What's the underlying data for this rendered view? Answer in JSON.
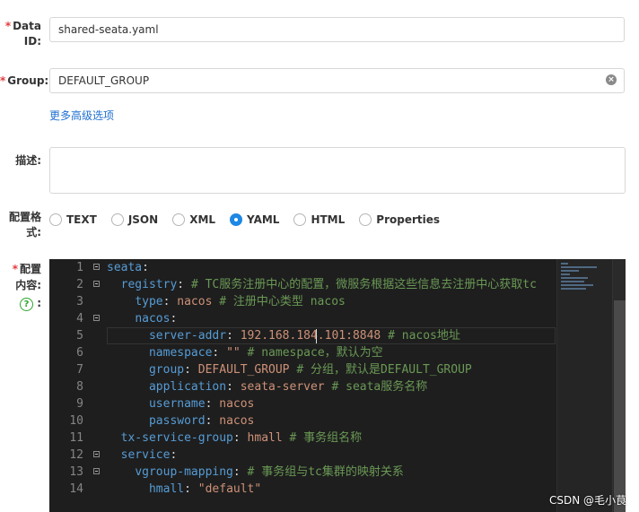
{
  "form": {
    "data_id": {
      "required_mark": "*",
      "label_line1": "Data",
      "label_line2": "ID:",
      "value": "shared-seata.yaml"
    },
    "group": {
      "required_mark": "*",
      "label": "Group:",
      "value": "DEFAULT_GROUP",
      "clear_icon": "clear-circle-icon"
    },
    "advanced_link": "更多高级选项",
    "description": {
      "label": "描述:",
      "value": ""
    },
    "format": {
      "label_line1": "配置格",
      "label_line2": "式:",
      "options": [
        "TEXT",
        "JSON",
        "XML",
        "YAML",
        "HTML",
        "Properties"
      ],
      "selected": "YAML"
    },
    "content": {
      "required_mark": "*",
      "label_line1": "配置",
      "label_line2": "内容:",
      "help_icon": "?",
      "colon": ":"
    }
  },
  "editor": {
    "cursor_line": 5,
    "lines": [
      {
        "n": "1",
        "fold": true,
        "indent": "",
        "key": "seata",
        "sep": ":",
        "val": "",
        "comment": ""
      },
      {
        "n": "2",
        "fold": true,
        "indent": "  ",
        "key": "registry",
        "sep": ": ",
        "val": "",
        "comment": "# TC服务注册中心的配置，微服务根据这些信息去注册中心获取tc"
      },
      {
        "n": "3",
        "fold": false,
        "indent": "    ",
        "key": "type",
        "sep": ": ",
        "val": "nacos",
        "comment": " # 注册中心类型 nacos"
      },
      {
        "n": "4",
        "fold": true,
        "indent": "    ",
        "key": "nacos",
        "sep": ":",
        "val": "",
        "comment": ""
      },
      {
        "n": "5",
        "fold": false,
        "indent": "      ",
        "key": "server-addr",
        "sep": ": ",
        "val": "192.168.184.101:8848",
        "comment": " # nacos地址"
      },
      {
        "n": "6",
        "fold": false,
        "indent": "      ",
        "key": "namespace",
        "sep": ": ",
        "val": "\"\"",
        "comment": " # namespace，默认为空"
      },
      {
        "n": "7",
        "fold": false,
        "indent": "      ",
        "key": "group",
        "sep": ": ",
        "val": "DEFAULT_GROUP",
        "comment": " # 分组，默认是DEFAULT_GROUP"
      },
      {
        "n": "8",
        "fold": false,
        "indent": "      ",
        "key": "application",
        "sep": ": ",
        "val": "seata-server",
        "comment": " # seata服务名称"
      },
      {
        "n": "9",
        "fold": false,
        "indent": "      ",
        "key": "username",
        "sep": ": ",
        "val": "nacos",
        "comment": ""
      },
      {
        "n": "10",
        "fold": false,
        "indent": "      ",
        "key": "password",
        "sep": ": ",
        "val": "nacos",
        "comment": ""
      },
      {
        "n": "11",
        "fold": false,
        "indent": "  ",
        "key": "tx-service-group",
        "sep": ": ",
        "val": "hmall",
        "comment": " # 事务组名称"
      },
      {
        "n": "12",
        "fold": true,
        "indent": "  ",
        "key": "service",
        "sep": ":",
        "val": "",
        "comment": ""
      },
      {
        "n": "13",
        "fold": true,
        "indent": "    ",
        "key": "vgroup-mapping",
        "sep": ": ",
        "val": "",
        "comment": "# 事务组与tc集群的映射关系"
      },
      {
        "n": "14",
        "fold": false,
        "indent": "      ",
        "key": "hmall",
        "sep": ": ",
        "val": "\"default\"",
        "comment": ""
      }
    ]
  },
  "watermark": "CSDN @毛小茛",
  "colors": {
    "accent": "#1e88e5",
    "link": "#1e6fd0",
    "required": "#e4393c",
    "editor_bg": "#1e1e1e",
    "key": "#569cd6",
    "string": "#ce9178",
    "comment": "#6a9955"
  }
}
